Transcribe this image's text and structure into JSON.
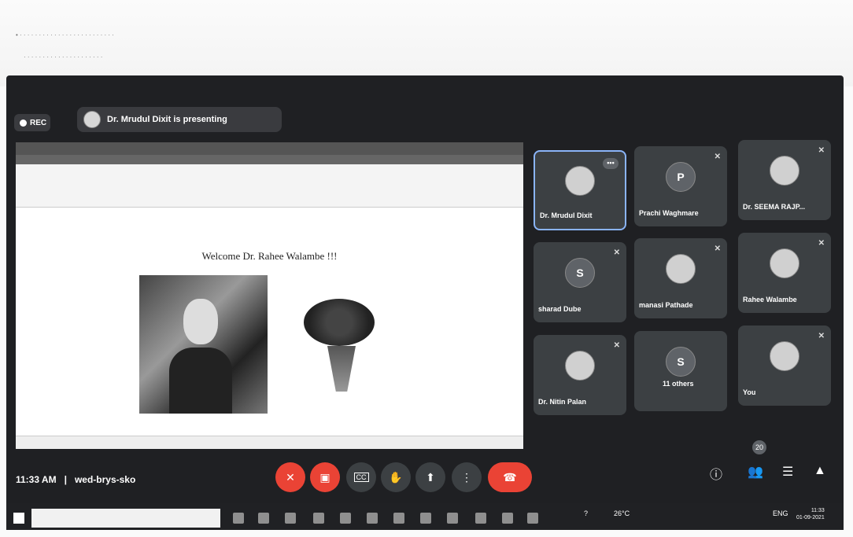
{
  "meeting": {
    "rec_label": "REC",
    "presenting_text": "Dr. Mrudul Dixit is presenting",
    "time": "11:33 AM",
    "separator": "|",
    "meeting_code": "wed-brys-sko",
    "participant_badge": "20"
  },
  "slide": {
    "title": "Welcome Dr. Rahee Walambe !!!"
  },
  "participants": [
    {
      "name": "Dr. Mrudul Dixit",
      "avatar": "photo",
      "active": true
    },
    {
      "name": "Prachi Waghmare",
      "avatar": "P"
    },
    {
      "name": "Dr. SEEMA RAJP...",
      "avatar": "photo"
    },
    {
      "name": "sharad Dube",
      "avatar": "S"
    },
    {
      "name": "manasi Pathade",
      "avatar": "photo"
    },
    {
      "name": "Rahee Walambe",
      "avatar": "photo"
    },
    {
      "name": "Dr. Nitin Palan",
      "avatar": "photo"
    },
    {
      "name": "11 others",
      "avatar": "S"
    },
    {
      "name": "You",
      "avatar": "photo"
    }
  ],
  "taskbar": {
    "temperature": "26°C",
    "language": "ENG",
    "clock_time": "11:33",
    "clock_date": "01-09-2021"
  },
  "icons": {
    "rec": "rec-dot-icon",
    "mic": "mic-off-icon",
    "camera": "camera-off-icon",
    "captions": "cc-icon",
    "hand": "hand-icon",
    "present": "present-icon",
    "more": "more-vert-icon",
    "end": "end-call-icon",
    "info": "info-icon",
    "people": "people-icon",
    "chat": "chat-icon",
    "activities": "activities-icon"
  },
  "colors": {
    "meet_bg": "#1f2023",
    "tile_bg": "#3c4043",
    "end_call": "#ea4335",
    "active_border": "#8ab4f8"
  }
}
